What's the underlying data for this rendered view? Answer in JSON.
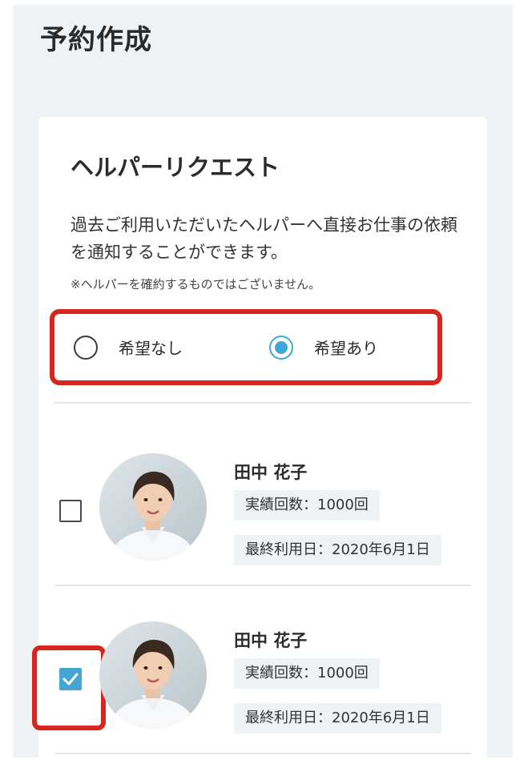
{
  "page": {
    "title": "予約作成"
  },
  "helper_request": {
    "title": "ヘルパーリクエスト",
    "description": "過去ご利用いただいたヘルパーへ直接お仕事の依頼を通知することができます。",
    "note": "※ヘルパーを確約するものではございません。",
    "options": [
      {
        "label": "希望なし",
        "selected": false
      },
      {
        "label": "希望あり",
        "selected": true
      }
    ]
  },
  "helpers": [
    {
      "name": "田中 花子",
      "count_text": "実績回数：1000回",
      "last_used_text": "最終利用日：2020年6月1日",
      "checked": false
    },
    {
      "name": "田中 花子",
      "count_text": "実績回数：1000回",
      "last_used_text": "最終利用日：2020年6月1日",
      "checked": true
    }
  ],
  "colors": {
    "accent": "#3fa6d8",
    "highlight": "#d8261f",
    "background": "#eef2f5"
  }
}
